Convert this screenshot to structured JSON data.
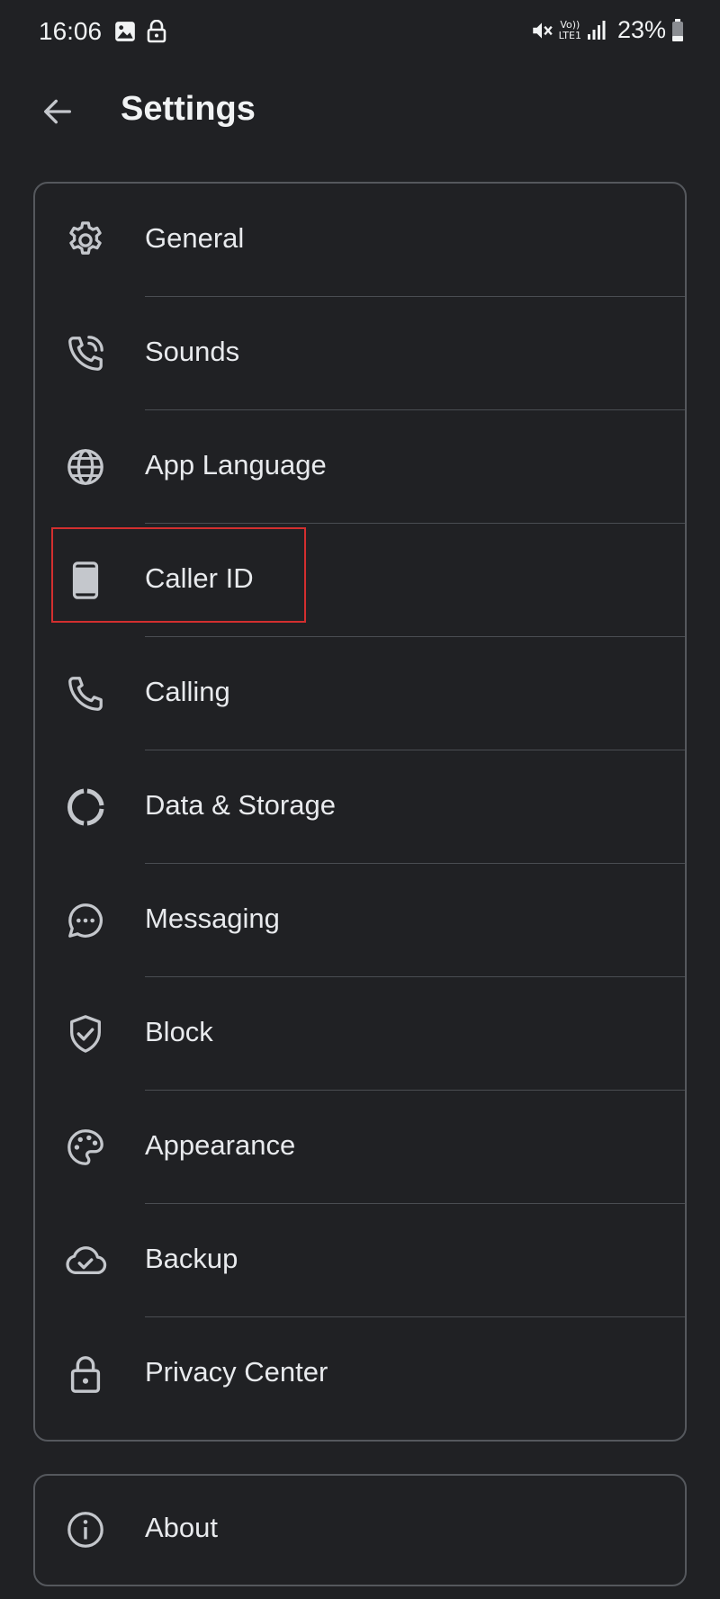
{
  "status_bar": {
    "time": "16:06",
    "battery": "23%",
    "network_line1": "Vo))",
    "network_line2": "LTE1",
    "icons": [
      "image-icon",
      "lock-icon",
      "mute-icon",
      "signal-icon",
      "battery-icon"
    ]
  },
  "header": {
    "title": "Settings",
    "back_icon": "back-arrow-icon"
  },
  "settings": {
    "items": [
      {
        "label": "General",
        "icon": "gear-icon"
      },
      {
        "label": "Sounds",
        "icon": "phone-ringing-icon"
      },
      {
        "label": "App Language",
        "icon": "globe-icon"
      },
      {
        "label": "Caller ID",
        "icon": "smartphone-icon"
      },
      {
        "label": "Calling",
        "icon": "phone-icon"
      },
      {
        "label": "Data & Storage",
        "icon": "donut-chart-icon"
      },
      {
        "label": "Messaging",
        "icon": "chat-bubble-icon"
      },
      {
        "label": "Block",
        "icon": "shield-check-icon"
      },
      {
        "label": "Appearance",
        "icon": "palette-icon"
      },
      {
        "label": "Backup",
        "icon": "cloud-check-icon"
      },
      {
        "label": "Privacy Center",
        "icon": "padlock-icon"
      }
    ]
  },
  "about": {
    "label": "About",
    "icon": "info-icon"
  },
  "colors": {
    "background": "#202124",
    "text": "#e8eaed",
    "icon": "#c4c7cc",
    "border": "#55585d",
    "highlight": "#d32f2f"
  }
}
